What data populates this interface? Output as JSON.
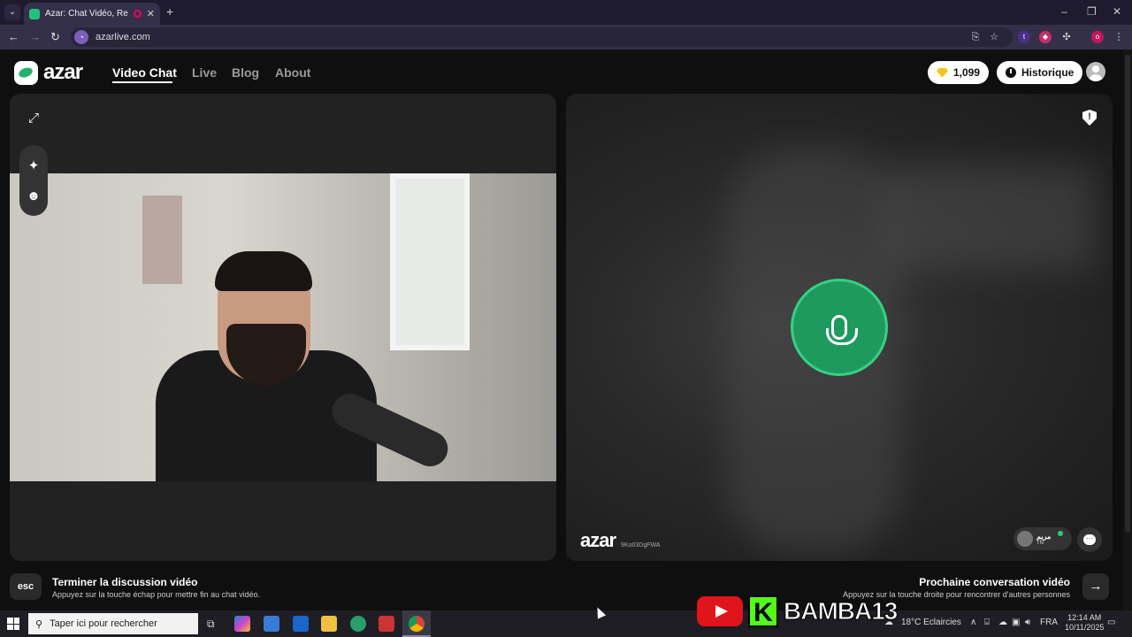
{
  "browser": {
    "tab_title": "Azar: Chat Vidéo, Rencontr",
    "url": "azarlive.com",
    "new_tab": "+",
    "tab_close": "✕"
  },
  "nav": {
    "logo": "azar",
    "links": [
      "Video Chat",
      "Live",
      "Blog",
      "About"
    ],
    "gems": "1,099",
    "history": "Historique"
  },
  "remote": {
    "watermark_logo": "azar",
    "watermark_id": "9Ko03DgFWA",
    "user_name": "مريم",
    "user_country": "TN"
  },
  "bottom": {
    "esc_key": "esc",
    "end_title": "Terminer la discussion vidéo",
    "end_sub": "Appuyez sur la touche échap pour mettre fin au chat vidéo.",
    "next_title": "Prochaine conversation vidéo",
    "next_sub": "Appuyez sur la touche droite pour rencontrer d'autres personnes",
    "next_arrow": "→"
  },
  "overlay": {
    "kick_letter": "K",
    "channel": "BAMBA13"
  },
  "taskbar": {
    "search_placeholder": "Taper ici pour rechercher",
    "weather": "18°C  Eclaircies",
    "lang": "FRA",
    "time": "12:14 AM",
    "date": "10/11/2025"
  },
  "colors": {
    "accent": "#1f9a5e",
    "background": "#0f0f0f",
    "panel": "#222222"
  }
}
